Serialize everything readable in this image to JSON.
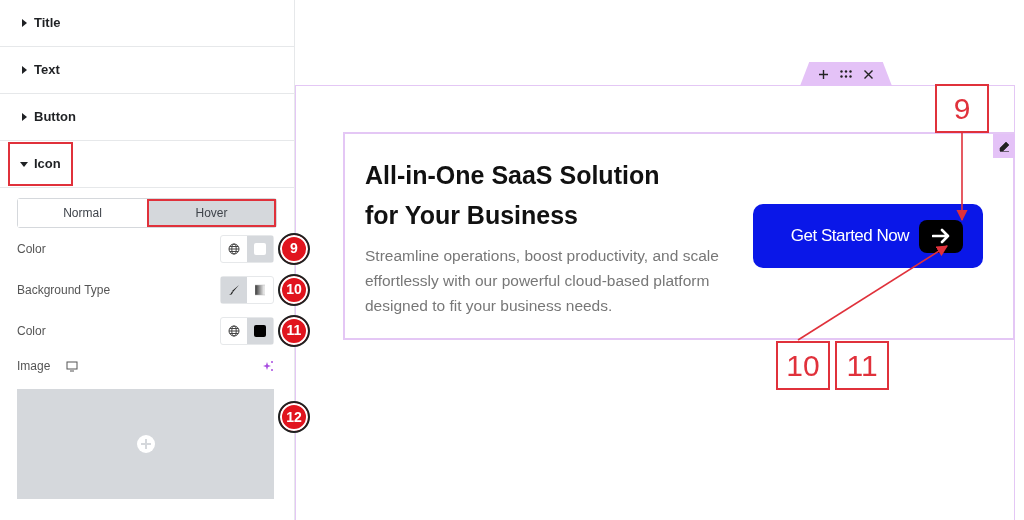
{
  "sections": [
    {
      "label": "Title",
      "expanded": false,
      "highlighted": false
    },
    {
      "label": "Text",
      "expanded": false,
      "highlighted": false
    },
    {
      "label": "Button",
      "expanded": false,
      "highlighted": false
    },
    {
      "label": "Icon",
      "expanded": true,
      "highlighted": true
    }
  ],
  "state_tabs": [
    {
      "label": "Normal",
      "selected": false,
      "highlighted": false
    },
    {
      "label": "Hover",
      "selected": true,
      "highlighted": true
    }
  ],
  "controls": [
    {
      "kind": "color",
      "label": "Color",
      "marker": "9",
      "color": "#ffffff"
    },
    {
      "kind": "background_type",
      "label": "Background Type",
      "marker": "10",
      "options": [
        {
          "selected": true
        },
        {
          "selected": false
        }
      ]
    },
    {
      "kind": "color",
      "label": "Color",
      "marker": "11",
      "color": "#000000"
    },
    {
      "kind": "image",
      "label": "Image",
      "marker": "12"
    }
  ],
  "preview": {
    "heading": "All-in-One SaaS Solution for Your Business",
    "description": "Streamline operations, boost productivity, and scale effortlessly with our powerful cloud-based platform designed to fit your business needs.",
    "button_label": "Get Started Now"
  },
  "callouts": [
    "9",
    "10",
    "11"
  ]
}
